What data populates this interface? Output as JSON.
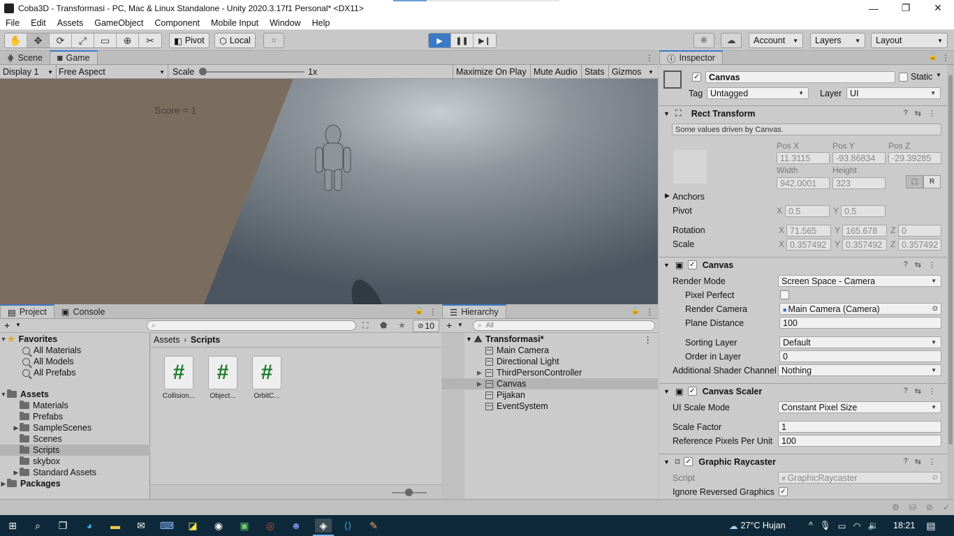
{
  "window": {
    "title": "Coba3D - Transformasi - PC, Mac & Linux Standalone - Unity 2020.3.17f1 Personal* <DX11>",
    "controls": [
      "—",
      "❐",
      "✕"
    ]
  },
  "menu": [
    "File",
    "Edit",
    "Assets",
    "GameObject",
    "Component",
    "Mobile Input",
    "Window",
    "Help"
  ],
  "toolbar": {
    "pivot": "Pivot",
    "local": "Local",
    "account": "Account",
    "layers": "Layers",
    "layout": "Layout",
    "play_state": "playing"
  },
  "scene_tabs": [
    "Scene",
    "Game"
  ],
  "game_toolbar": {
    "display": "Display 1",
    "aspect": "Free Aspect",
    "scale_label": "Scale",
    "scale_value": "1x",
    "maximize": "Maximize On Play",
    "mute": "Mute Audio",
    "stats": "Stats",
    "gizmos": "Gizmos"
  },
  "game_view": {
    "score_text": "Score = 1"
  },
  "project": {
    "tabs": [
      "Project",
      "Console"
    ],
    "hidden_count": "10",
    "breadcrumb": [
      "Assets",
      "Scripts"
    ],
    "tree": {
      "favorites": "Favorites",
      "fav_items": [
        "All Materials",
        "All Models",
        "All Prefabs"
      ],
      "assets": "Assets",
      "asset_items": [
        "Materials",
        "Prefabs",
        "SampleScenes",
        "Scenes",
        "Scripts",
        "skybox",
        "Standard Assets"
      ],
      "packages": "Packages"
    },
    "files": [
      "Collision...",
      "Object...",
      "OrbitC..."
    ],
    "file_glyph": "#"
  },
  "hierarchy": {
    "tab": "Hierarchy",
    "search_placeholder": "All",
    "scene": "Transformasi*",
    "items": [
      "Main Camera",
      "Directional Light",
      "ThirdPersonController",
      "Canvas",
      "Pijakan",
      "EventSystem"
    ]
  },
  "inspector": {
    "tab": "Inspector",
    "object_name": "Canvas",
    "static_label": "Static",
    "tag_label": "Tag",
    "tag_value": "Untagged",
    "layer_label": "Layer",
    "layer_value": "UI",
    "rect_transform": {
      "title": "Rect Transform",
      "note": "Some values driven by Canvas.",
      "pos_x_label": "Pos X",
      "pos_x": "11.3115",
      "pos_y_label": "Pos Y",
      "pos_y": "-93.86834",
      "pos_z_label": "Pos Z",
      "pos_z": "-29.39285",
      "width_label": "Width",
      "width": "942.0001",
      "height_label": "Height",
      "height": "323",
      "anchors": "Anchors",
      "pivot": "Pivot",
      "pivot_x": "0.5",
      "pivot_y": "0.5",
      "rotation": "Rotation",
      "rot_x": "71.565",
      "rot_y": "165.678",
      "rot_z": "0",
      "scale": "Scale",
      "scale_x": "0.357492",
      "scale_y": "0.357492",
      "scale_z": "0.357492",
      "raw_button": "R"
    },
    "canvas": {
      "title": "Canvas",
      "render_mode_label": "Render Mode",
      "render_mode": "Screen Space - Camera",
      "pixel_perfect_label": "Pixel Perfect",
      "render_camera_label": "Render Camera",
      "render_camera": "Main Camera (Camera)",
      "plane_distance_label": "Plane Distance",
      "plane_distance": "100",
      "sorting_layer_label": "Sorting Layer",
      "sorting_layer": "Default",
      "order_label": "Order in Layer",
      "order": "0",
      "shader_label": "Additional Shader Channel",
      "shader": "Nothing"
    },
    "canvas_scaler": {
      "title": "Canvas Scaler",
      "mode_label": "UI Scale Mode",
      "mode": "Constant Pixel Size",
      "factor_label": "Scale Factor",
      "factor": "1",
      "ref_label": "Reference Pixels Per Unit",
      "ref": "100"
    },
    "raycaster": {
      "title": "Graphic Raycaster",
      "script_label": "Script",
      "script": "GraphicRaycaster",
      "ignore_label": "Ignore Reversed Graphics"
    }
  },
  "taskbar": {
    "weather": "27°C  Hujan",
    "time": "18:21"
  },
  "colors": {
    "play_blue": "#3a79c5",
    "panel_bg": "#cbcbcb",
    "script_green": "#1e7a2e",
    "taskbar": "#0e2a3a"
  }
}
